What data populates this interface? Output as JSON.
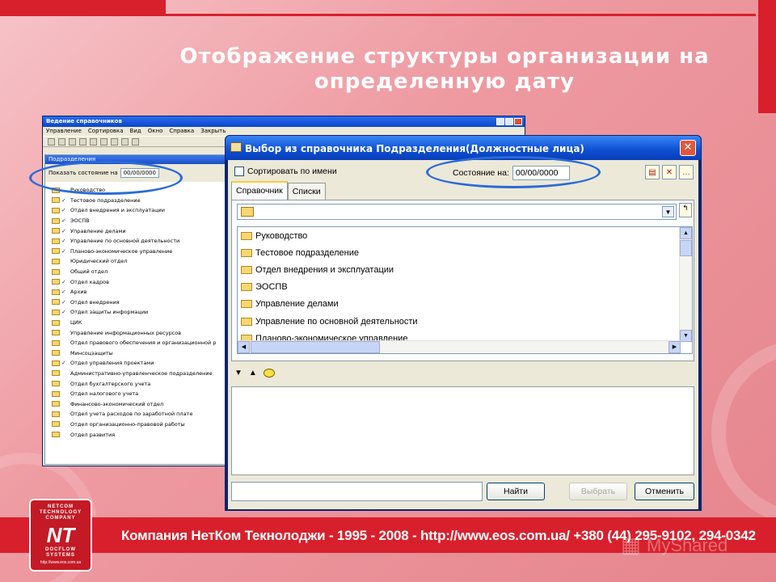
{
  "slide": {
    "title": "Отображение структуры организации на определенную дату",
    "footer": "Компания НетКом Текнолоджи - 1995 - 2008 - http://www.eos.com.ua/ +380 (44) 295-9102, 294-0342",
    "logo": {
      "top": "NETCOM TECHNOLOGY COMPANY",
      "mark": "NT",
      "bottom": "DOCFLOW SYSTEMS",
      "url": "http://www.eos.com.ua"
    },
    "watermark": "MyShared"
  },
  "back_window": {
    "title": "Ведение справочников",
    "menu": [
      "Управление",
      "Сортировка",
      "Вид",
      "Окно",
      "Справка",
      "Закрыть"
    ],
    "subwindow_title": "Подразделения",
    "date_label": "Показать состояние на",
    "date_value": "00/00/0000",
    "tree": [
      {
        "label": "Руководство",
        "checked": false
      },
      {
        "label": "Тестовое подразделение",
        "checked": true
      },
      {
        "label": "Отдел внедрения и эксплуатации",
        "checked": true
      },
      {
        "label": "ЭОСПВ",
        "checked": true
      },
      {
        "label": "Управление делами",
        "checked": true
      },
      {
        "label": "Управление по основной деятельности",
        "checked": true
      },
      {
        "label": "Планово-экономическое управление",
        "checked": true
      },
      {
        "label": "Юридический отдел",
        "checked": false
      },
      {
        "label": "Общий отдел",
        "checked": false
      },
      {
        "label": "Отдел кадров",
        "checked": true
      },
      {
        "label": "Архив",
        "checked": true
      },
      {
        "label": "Отдел внедрения",
        "checked": true
      },
      {
        "label": "Отдел защиты информации",
        "checked": true
      },
      {
        "label": "ЦИК",
        "checked": false
      },
      {
        "label": "Управление информационных ресурсов",
        "checked": false
      },
      {
        "label": "Отдел правового обеспечения и организационной р",
        "checked": false
      },
      {
        "label": "Минсоцзащиты",
        "checked": false
      },
      {
        "label": "Отдел управления проектами",
        "checked": true
      },
      {
        "label": "Административно-управленческое подразделение",
        "checked": false
      },
      {
        "label": "Отдел бухгалтерского учета",
        "checked": false
      },
      {
        "label": "Отдел налогового учета",
        "checked": false
      },
      {
        "label": "Финансово-экономический отдел",
        "checked": false
      },
      {
        "label": "Отдел учета расходов по заработной плате",
        "checked": false
      },
      {
        "label": "Отдел организационно-правовой работы",
        "checked": false
      },
      {
        "label": "Отдел развития",
        "checked": false
      }
    ]
  },
  "dialog": {
    "title": "Выбор из справочника Подразделения(Должностные лица)",
    "sort_label": "Сортировать по имени",
    "state_label": "Состояние на:",
    "state_value": "00/00/0000",
    "tabs": [
      "Справочник",
      "Списки"
    ],
    "list": [
      "Руководство",
      "Тестовое подразделение",
      "Отдел внедрения и эксплуатации",
      "ЭОСПВ",
      "Управление делами",
      "Управление по основной деятельности",
      "Планово-экономическое управление"
    ],
    "search_value": "",
    "buttons": {
      "find": "Найти",
      "select": "Выбрать",
      "cancel": "Отменить"
    }
  }
}
